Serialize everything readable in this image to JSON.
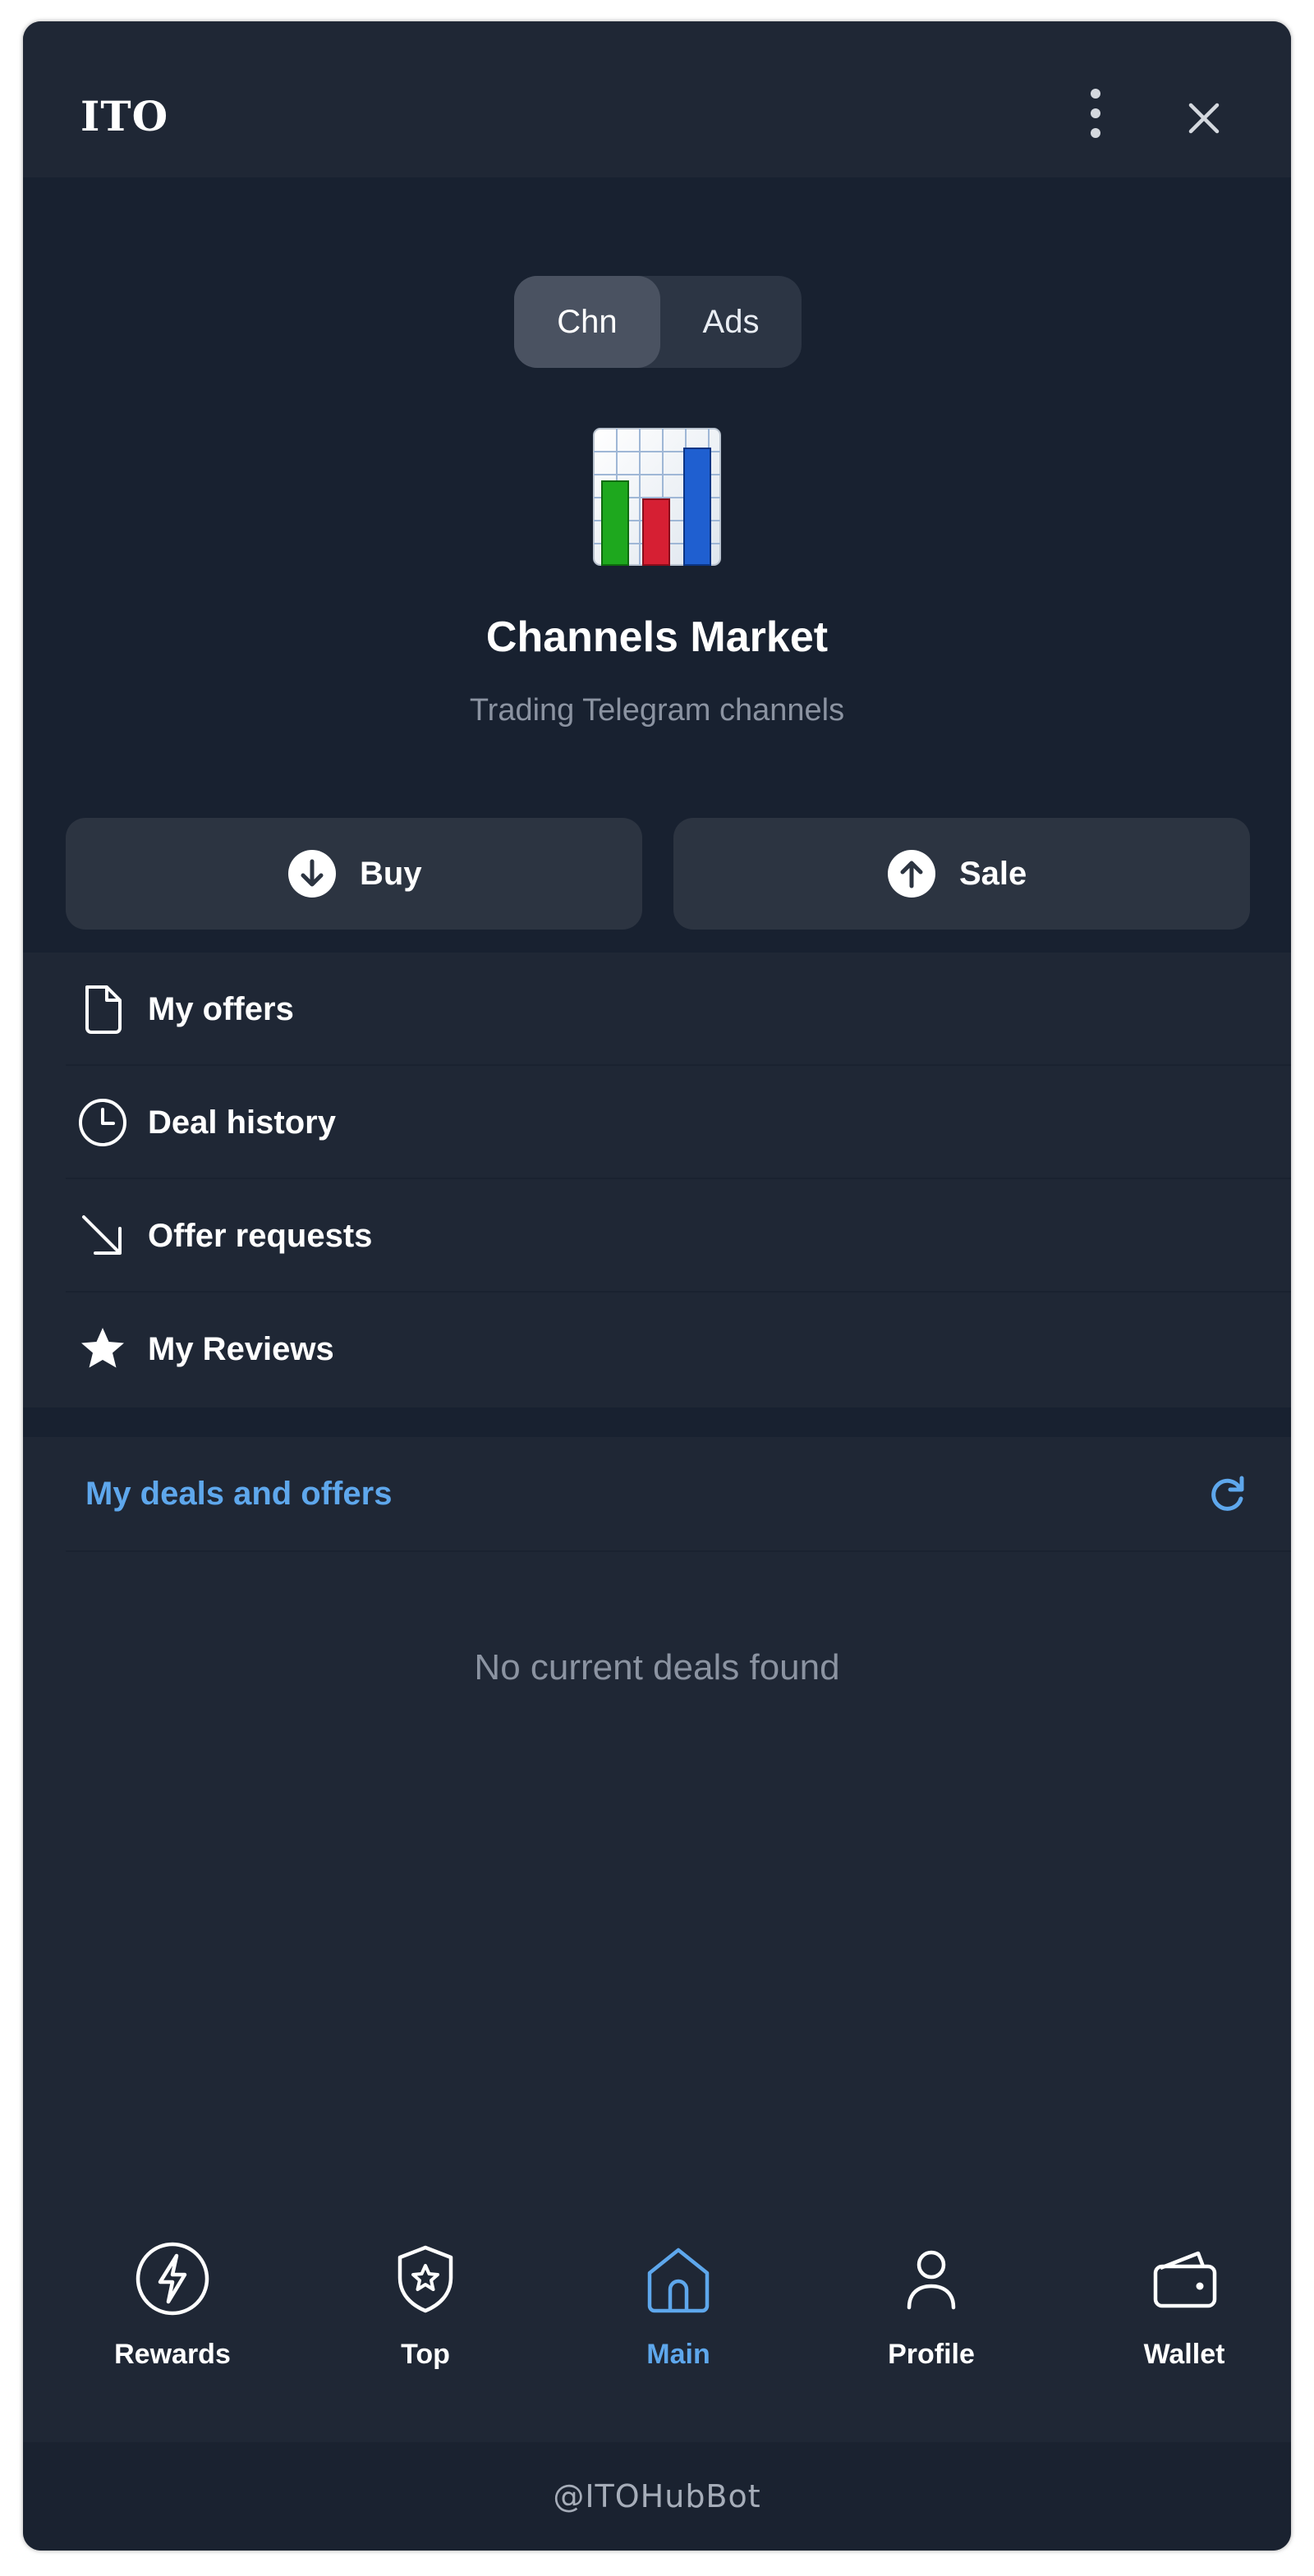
{
  "header": {
    "title": "ITO",
    "menu_icon": "more-vertical-icon",
    "close_icon": "close-icon"
  },
  "segment": {
    "options": [
      "Chn",
      "Ads"
    ],
    "selected": "Chn"
  },
  "hero": {
    "icon": "bar-chart-icon",
    "title": "Channels Market",
    "subtitle": "Trading Telegram channels"
  },
  "actions": {
    "buy_label": "Buy",
    "sale_label": "Sale"
  },
  "menu": {
    "items": [
      {
        "label": "My offers",
        "icon": "document-icon"
      },
      {
        "label": "Deal history",
        "icon": "clock-icon"
      },
      {
        "label": "Offer requests",
        "icon": "arrow-down-right-icon"
      },
      {
        "label": "My Reviews",
        "icon": "star-icon"
      }
    ]
  },
  "deals": {
    "title": "My deals and offers",
    "empty_text": "No current deals found",
    "refresh_icon": "refresh-icon"
  },
  "tabs": [
    {
      "label": "Rewards",
      "icon": "lightning-icon"
    },
    {
      "label": "Top",
      "icon": "shield-star-icon"
    },
    {
      "label": "Main",
      "icon": "home-icon",
      "active": true
    },
    {
      "label": "Profile",
      "icon": "user-icon"
    },
    {
      "label": "Wallet",
      "icon": "wallet-icon"
    }
  ],
  "footer": {
    "bot_name": "@ITOHubBot"
  },
  "colors": {
    "accent": "#5ea7ec",
    "background": "#1f2735",
    "surface": "#2c3441"
  }
}
